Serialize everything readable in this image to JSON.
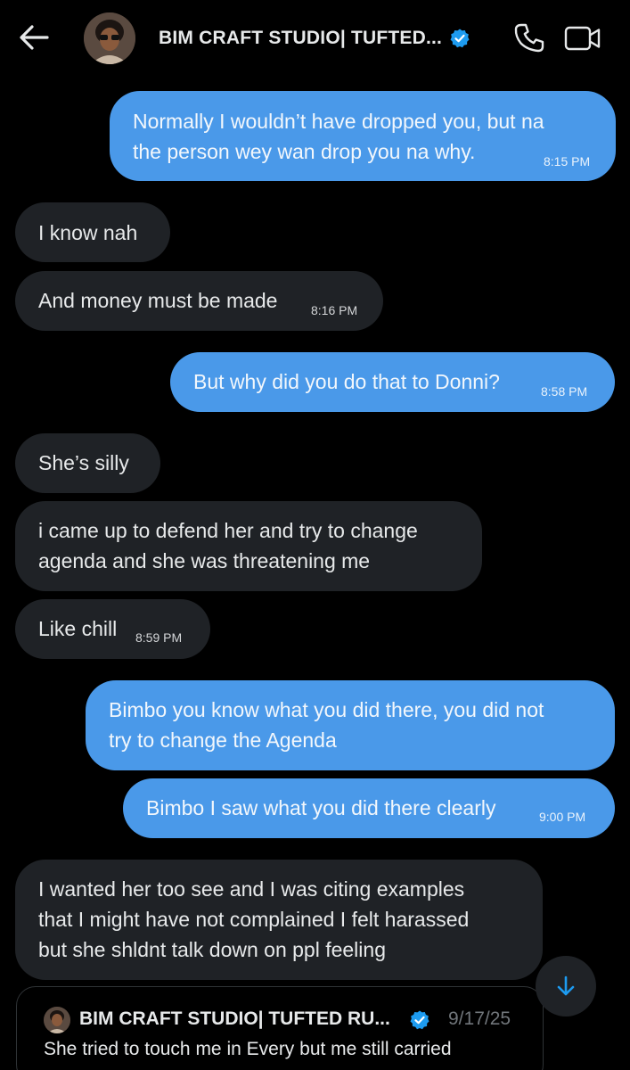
{
  "header": {
    "title": "BIM CRAFT STUDIO| TUFTED...",
    "back_icon": "arrow-left-icon",
    "call_icon": "phone-icon",
    "video_icon": "video-camera-icon",
    "verified_icon": "verified-badge-icon"
  },
  "colors": {
    "background": "#000000",
    "outgoing_bubble": "#4a99e9",
    "incoming_bubble": "#1f2226",
    "verified": "#1d9bf0",
    "muted_text": "#71767b"
  },
  "messages": [
    {
      "direction": "outgoing",
      "lines": [
        "Normally I wouldn’t have dropped you, but na",
        "the person wey wan drop you na why."
      ],
      "time": "8:15 PM"
    },
    {
      "direction": "incoming",
      "lines": [
        "I know nah"
      ],
      "time": ""
    },
    {
      "direction": "incoming",
      "lines": [
        "And money must be made"
      ],
      "time": "8:16 PM"
    },
    {
      "direction": "outgoing",
      "lines": [
        "But why did you do that to Donni?"
      ],
      "time": "8:58 PM"
    },
    {
      "direction": "incoming",
      "lines": [
        "She’s silly"
      ],
      "time": ""
    },
    {
      "direction": "incoming",
      "lines": [
        "i came up to defend her and try to change",
        "agenda and she was threatening me"
      ],
      "time": ""
    },
    {
      "direction": "incoming",
      "lines": [
        "Like chill"
      ],
      "time": "8:59 PM"
    },
    {
      "direction": "outgoing",
      "lines": [
        "Bimbo you know what you did there, you did not",
        "try to change the Agenda"
      ],
      "time": ""
    },
    {
      "direction": "outgoing",
      "lines": [
        "Bimbo I saw what you did there clearly"
      ],
      "time": "9:00 PM"
    },
    {
      "direction": "incoming",
      "lines": [
        "I wanted her too see and I was citing examples",
        "that I might have not complained I felt harassed",
        "but she shldnt talk down on ppl feeling"
      ],
      "time": ""
    }
  ],
  "quoted_post": {
    "author": "BIM CRAFT STUDIO| TUFTED RU...",
    "date": "9/17/25",
    "body_preview": "She tried to touch me in Every but me still carried"
  },
  "scroll_button_icon": "arrow-down-icon"
}
